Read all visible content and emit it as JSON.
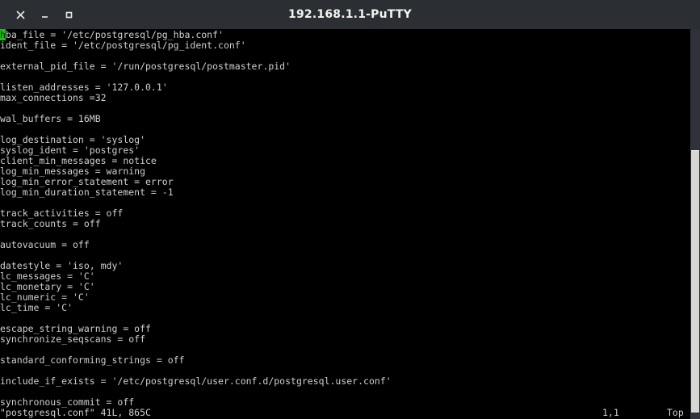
{
  "window": {
    "titlebar": {
      "host": "192.168.1.1",
      "separator": "  - ",
      "app": "PuTTY",
      "full_title": "192.168.1.1  - PuTTY",
      "buttons": [
        {
          "name": "close",
          "glyph": "✕"
        },
        {
          "name": "minimize",
          "glyph": "–"
        },
        {
          "name": "maximize",
          "glyph": "□"
        }
      ],
      "background_color": "#2b2e33",
      "text_color": "#f2f2f2"
    },
    "colors": {
      "terminal_background": "#000000",
      "terminal_foreground": "#cfcfcf",
      "cursor": "#16c60c",
      "scrollbar_track": "#2f3238",
      "scrollbar_thumb": "#d6d6d2"
    }
  },
  "terminal": {
    "cursor": {
      "char": "h",
      "row": 0,
      "col": 0
    },
    "lines": [
      "ba_file = '/etc/postgresql/pg_hba.conf'",
      "ident_file = '/etc/postgresql/pg_ident.conf'",
      "",
      "external_pid_file = '/run/postgresql/postmaster.pid'",
      "",
      "listen_addresses = '127.0.0.1'",
      "max_connections =32",
      "",
      "wal_buffers = 16MB",
      "",
      "log_destination = 'syslog'",
      "syslog_ident = 'postgres'",
      "client_min_messages = notice",
      "log_min_messages = warning",
      "log_min_error_statement = error",
      "log_min_duration_statement = -1",
      "",
      "track_activities = off",
      "track_counts = off",
      "",
      "autovacuum = off",
      "",
      "datestyle = 'iso, mdy'",
      "lc_messages = 'C'",
      "lc_monetary = 'C'",
      "lc_numeric = 'C'",
      "lc_time = 'C'",
      "",
      "escape_string_warning = off",
      "synchronize_seqscans = off",
      "",
      "standard_conforming_strings = off",
      "",
      "include_if_exists = '/etc/postgresql/user.conf.d/postgresql.user.conf'",
      "",
      "synchronous_commit = off"
    ],
    "status": {
      "file_info": "\"postgresql.conf\" 41L, 865C",
      "position": "1,1",
      "scroll": "Top"
    }
  }
}
